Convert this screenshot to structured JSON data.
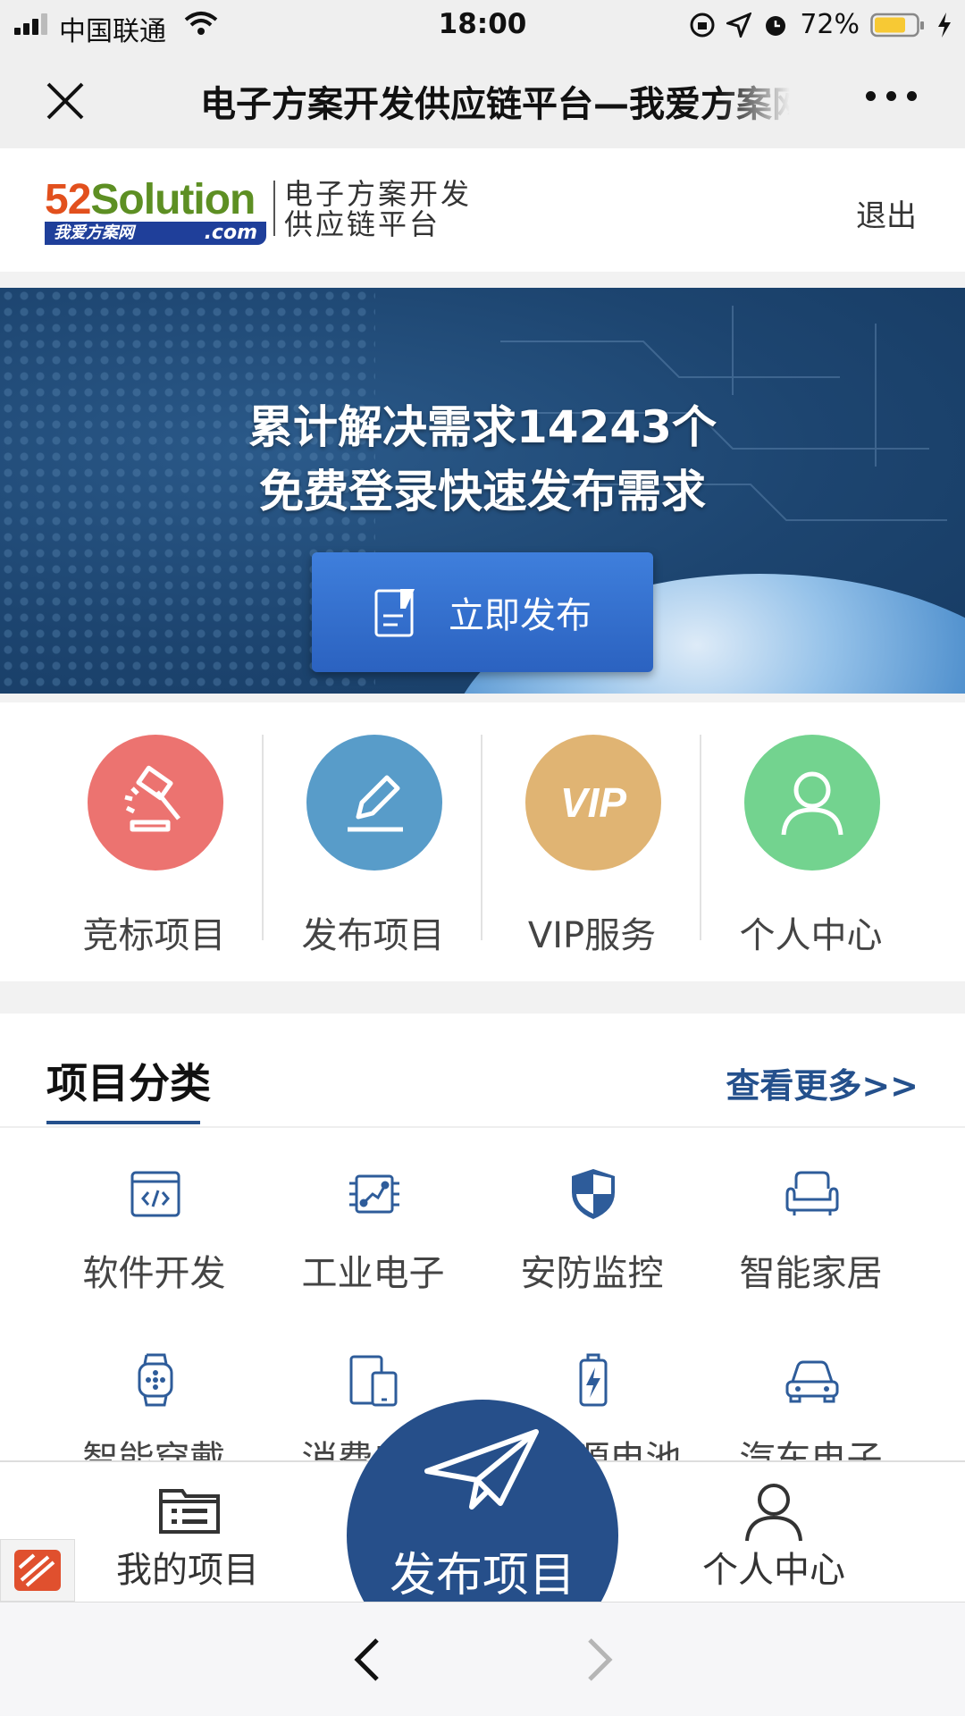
{
  "status_bar": {
    "carrier": "中国联通",
    "time": "18:00",
    "battery": "72%",
    "battery_color": "#f7c934"
  },
  "nav_bar": {
    "title": "电子方案开发供应链平台—我爱方案网",
    "close_icon": "close-icon",
    "more_icon": "more-icon"
  },
  "site_header": {
    "logo_brand_52": "52",
    "logo_brand_rest": "Solution",
    "logo_sub_cn": "我爱方案网",
    "logo_sub_com": ".com",
    "logo_text_line1": "电子方案开发",
    "logo_text_line2": "供应链平台",
    "logout": "退出"
  },
  "banner": {
    "line1": "累计解决需求14243个",
    "line2": "免费登录快速发布需求",
    "button": "立即发布"
  },
  "quick_actions": [
    {
      "label": "竞标项目",
      "icon": "gavel-icon",
      "color": "#ec7370"
    },
    {
      "label": "发布项目",
      "icon": "pencil-icon",
      "color": "#589cc9"
    },
    {
      "label": "VIP服务",
      "icon": "vip-icon",
      "color": "#e0b473"
    },
    {
      "label": "个人中心",
      "icon": "user-icon",
      "color": "#73d38f"
    }
  ],
  "category": {
    "title": "项目分类",
    "more": "查看更多>>",
    "items": [
      {
        "label": "软件开发",
        "icon": "code-window-icon"
      },
      {
        "label": "工业电子",
        "icon": "circuit-board-icon"
      },
      {
        "label": "安防监控",
        "icon": "shield-icon"
      },
      {
        "label": "智能家居",
        "icon": "sofa-icon"
      },
      {
        "label": "智能穿戴",
        "icon": "smartwatch-icon"
      },
      {
        "label": "消费电子",
        "icon": "devices-icon"
      },
      {
        "label": "新能源电池",
        "icon": "battery-icon"
      },
      {
        "label": "汽车电子",
        "icon": "car-icon"
      }
    ]
  },
  "tabbar": {
    "my_projects": "我的项目",
    "publish": "发布项目",
    "profile": "个人中心"
  },
  "accent_color": "#264f8a"
}
